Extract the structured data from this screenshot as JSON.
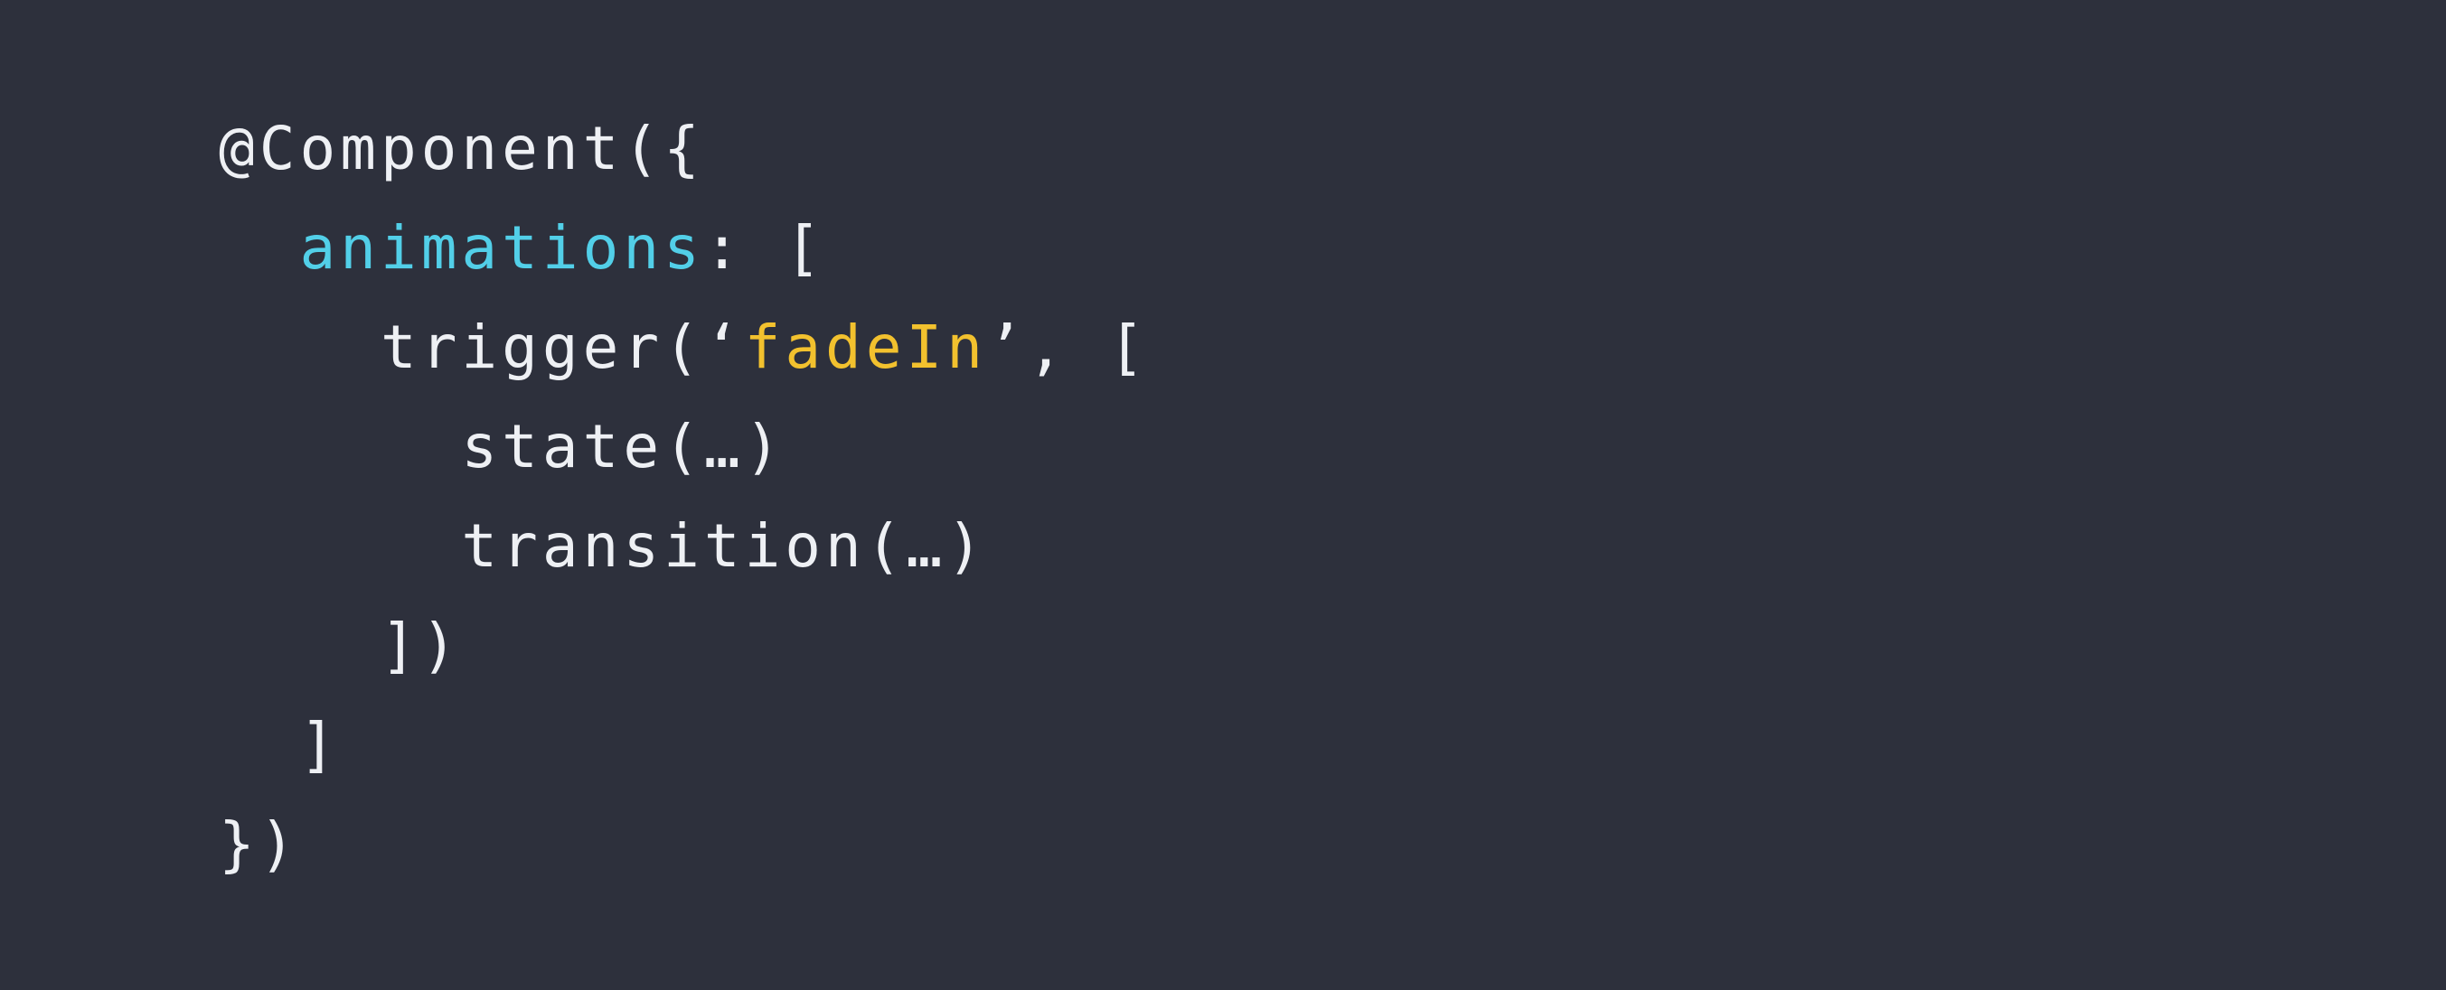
{
  "colors": {
    "background": "#2d303c",
    "text": "#eef0f4",
    "property": "#52cfe8",
    "string": "#f2c12e"
  },
  "code": {
    "line1": {
      "text": "@Component({"
    },
    "line2": {
      "indent": "  ",
      "key": "animations",
      "rest": ": ["
    },
    "line3": {
      "indent": "    ",
      "before": "trigger(‘",
      "string": "fadeIn",
      "after": "’, ["
    },
    "line4": {
      "indent": "      ",
      "text": "state(…)"
    },
    "line5": {
      "indent": "      ",
      "text": "transition(…)"
    },
    "line6": {
      "indent": "    ",
      "text": "])"
    },
    "line7": {
      "indent": "  ",
      "text": "]"
    },
    "line8": {
      "text": "})"
    }
  }
}
